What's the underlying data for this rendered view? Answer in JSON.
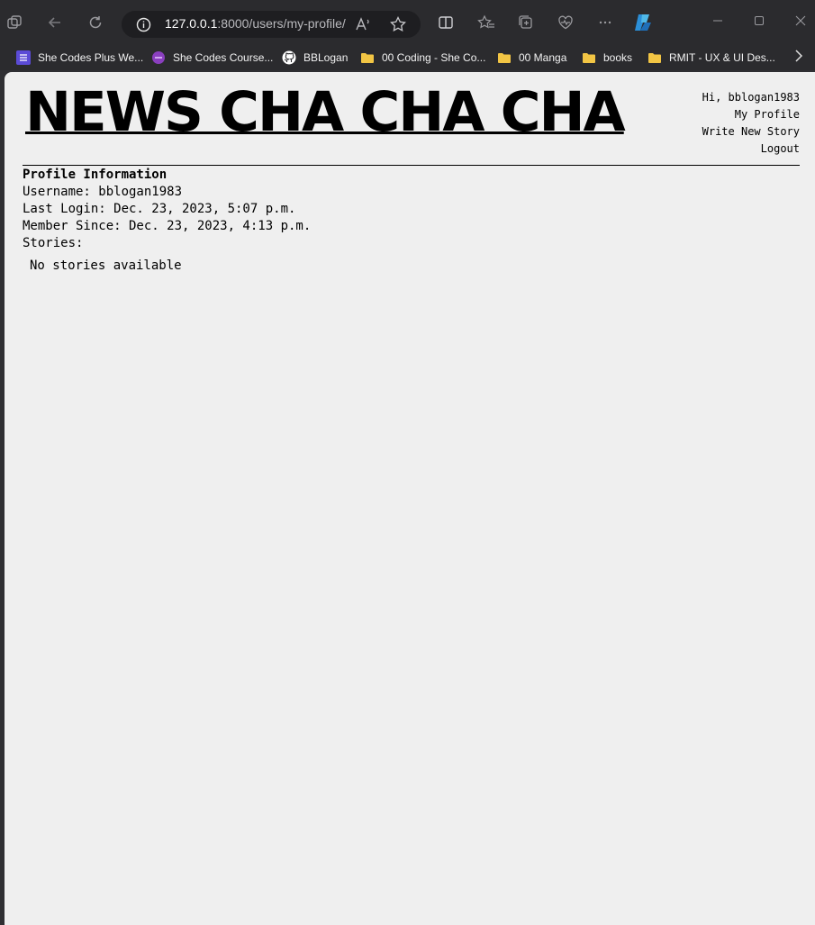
{
  "browser": {
    "url_host": "127.0.0.1",
    "url_path": ":8000/users/my-profile/",
    "bookmarks": [
      {
        "label": "She Codes Plus We...",
        "icon": "list-icon",
        "color": "#5b4bd6"
      },
      {
        "label": "She Codes Course...",
        "icon": "circle-icon",
        "color": "#8a3fbf"
      },
      {
        "label": "BBLogan",
        "icon": "github-icon",
        "color": "#ffffff"
      },
      {
        "label": "00 Coding - She Co...",
        "icon": "folder-icon",
        "color": "#f2c544"
      },
      {
        "label": "00 Manga",
        "icon": "folder-icon",
        "color": "#f2c544"
      },
      {
        "label": "books",
        "icon": "folder-icon",
        "color": "#f2c544"
      },
      {
        "label": "RMIT - UX & UI Des...",
        "icon": "folder-icon",
        "color": "#f2c544"
      }
    ]
  },
  "site": {
    "title": "NEWS CHA CHA CHA"
  },
  "nav": {
    "greeting": "Hi, bblogan1983",
    "my_profile": "My Profile",
    "write_new_story": "Write New Story",
    "logout": "Logout"
  },
  "profile": {
    "heading": "Profile Information",
    "username": "Username: bblogan1983",
    "last_login": "Last Login: Dec. 23, 2023, 5:07 p.m.",
    "member_since": "Member Since: Dec. 23, 2023, 4:13 p.m.",
    "stories_label": "Stories:",
    "no_stories": "No stories available"
  }
}
